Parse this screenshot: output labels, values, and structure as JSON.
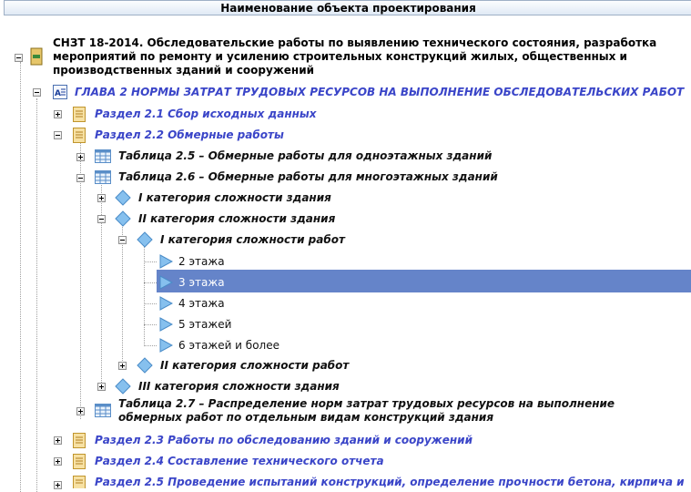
{
  "header": {
    "title": "Наименование объекта проектирования"
  },
  "root": {
    "lines": [
      "СНЗТ 18-2014. Обследовательские работы по выявлению технического состояния, разработка",
      "мероприятий по ремонту и усилению строительных конструкций жилых, общественных и",
      "производственных зданий и сооружений"
    ]
  },
  "chapter": {
    "label": "ГЛАВА 2  НОРМЫ ЗАТРАТ ТРУДОВЫХ РЕСУРСОВ НА ВЫПОЛНЕНИЕ ОБСЛЕДОВАТЕЛЬСКИХ РАБОТ"
  },
  "sections": {
    "s21": "Раздел 2.1  Сбор исходных данных",
    "s22": "Раздел 2.2  Обмерные работы",
    "s23": "Раздел 2.3  Работы по обследованию зданий и сооружений",
    "s24": "Раздел 2.4  Составление технического отчета",
    "s25": "Раздел 2.5 Проведение испытаний конструкций, определение прочности бетона, кирпича и"
  },
  "tables": {
    "t25": "Таблица 2.5 – Обмерные работы для одноэтажных зданий",
    "t26": "Таблица 2.6 – Обмерные работы для многоэтажных зданий",
    "t27_line1": "Таблица 2.7 – Распределение норм затрат трудовых ресурсов на выполнение",
    "t27_line2": "обмерных работ по отдельным видам конструкций здания"
  },
  "building_categories": {
    "cat1": "I категория сложности здания",
    "cat2": "II категория сложности здания",
    "cat3": "III категория сложности здания"
  },
  "work_categories": {
    "w1": "I категория сложности работ",
    "w2": "II категория сложности работ"
  },
  "floors": {
    "f2": "2 этажа",
    "f3": "3 этажа",
    "f4": "4 этажа",
    "f5": "5 этажей",
    "f6": "6 этажей и более"
  },
  "selected": "3 этажа",
  "colors": {
    "selection": "#6584c9",
    "link_text": "#3a45c8",
    "icon_blue": "#6aaee8"
  }
}
